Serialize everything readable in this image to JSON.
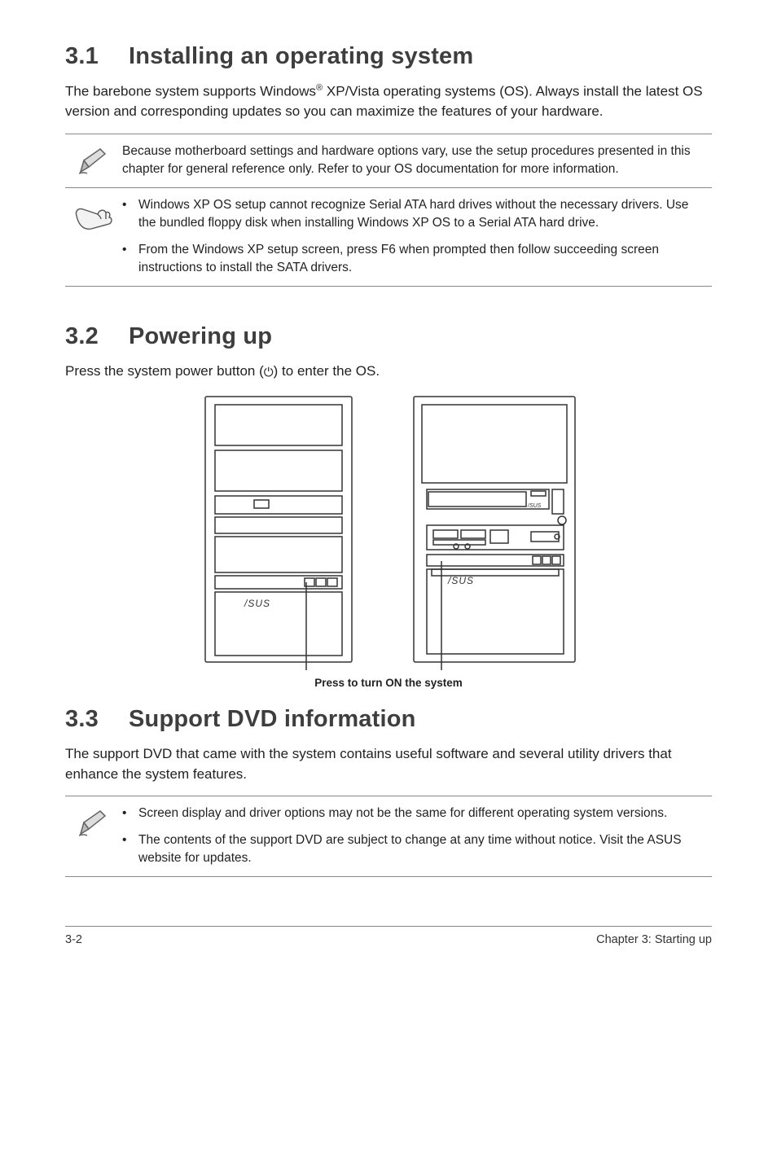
{
  "s31": {
    "num": "3.1",
    "title": "Installing an operating system",
    "p1a": "The barebone system supports Windows",
    "p1sup": "®",
    "p1b": " XP/Vista operating systems (OS). Always install the latest OS version and corresponding updates so you can maximize the features of your hardware.",
    "note1": "Because motherboard settings and hardware options vary, use the setup procedures presented in this chapter for general reference only. Refer to your OS documentation for more information.",
    "note2a": "Windows XP OS setup cannot recognize Serial ATA hard drives without the necessary drivers. Use the bundled floppy disk when installing Windows XP OS to a Serial ATA hard drive.",
    "note2b": "From the Windows XP setup screen, press F6 when prompted then follow succeeding screen instructions to install the SATA drivers."
  },
  "s32": {
    "num": "3.2",
    "title": "Powering up",
    "p1a": "Press the system power button (",
    "p1glyph": "⏻",
    "p1b": ") to enter the OS.",
    "caption": "Press to turn ON the system"
  },
  "s33": {
    "num": "3.3",
    "title": "Support DVD information",
    "p1": "The support DVD that came with the system contains useful software and several utility drivers that enhance the system features.",
    "note1a": "Screen display and driver options may not be the same for different operating system versions.",
    "note1b": "The contents of the support DVD are subject to change at any time without notice. Visit the ASUS website for updates."
  },
  "footer": {
    "left": "3-2",
    "right": "Chapter 3: Starting up"
  },
  "bullet": "•"
}
